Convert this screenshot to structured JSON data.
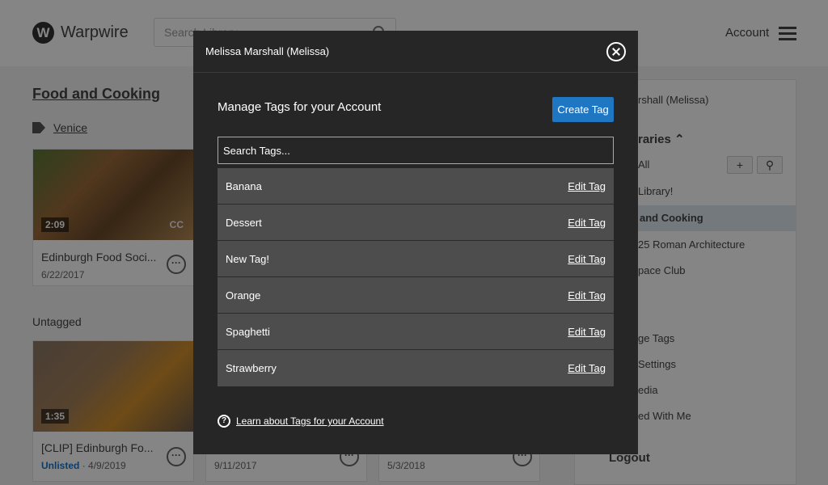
{
  "app": {
    "brand": "Warpwire",
    "logo_letter": "W"
  },
  "header": {
    "search_placeholder": "Search Library",
    "account_label": "Account"
  },
  "library": {
    "title": "Food and Cooking",
    "tag_label": "Venice",
    "untagged_label": "Untagged",
    "cards": [
      {
        "duration": "2:09",
        "cc": "CC",
        "title": "Edinburgh Food Soci...",
        "date": "6/22/2017"
      },
      {
        "duration": "1:35",
        "title": "[CLIP] Edinburgh Fo...",
        "status": "Unlisted",
        "date": "· 4/9/2019"
      },
      {
        "date": "9/11/2017"
      },
      {
        "date": "5/3/2018"
      }
    ]
  },
  "right_panel": {
    "user": "rshall (Melissa)",
    "libraries_heading": "raries",
    "all_label": "All",
    "items": [
      "Library!",
      "and Cooking",
      "25 Roman Architecture",
      "pace Club"
    ],
    "menu": [
      "ge Tags",
      "Settings",
      "edia",
      "ed With Me"
    ],
    "logout": "Logout"
  },
  "modal": {
    "user_name": "Melissa Marshall (Melissa)",
    "title": "Manage Tags for your Account",
    "create_button": "Create Tag",
    "search_placeholder": "Search Tags...",
    "edit_label": "Edit Tag",
    "tags": [
      "Banana",
      "Dessert",
      "New Tag!",
      "Orange",
      "Spaghetti",
      "Strawberry"
    ],
    "learn_link": "Learn about Tags for your Account"
  }
}
